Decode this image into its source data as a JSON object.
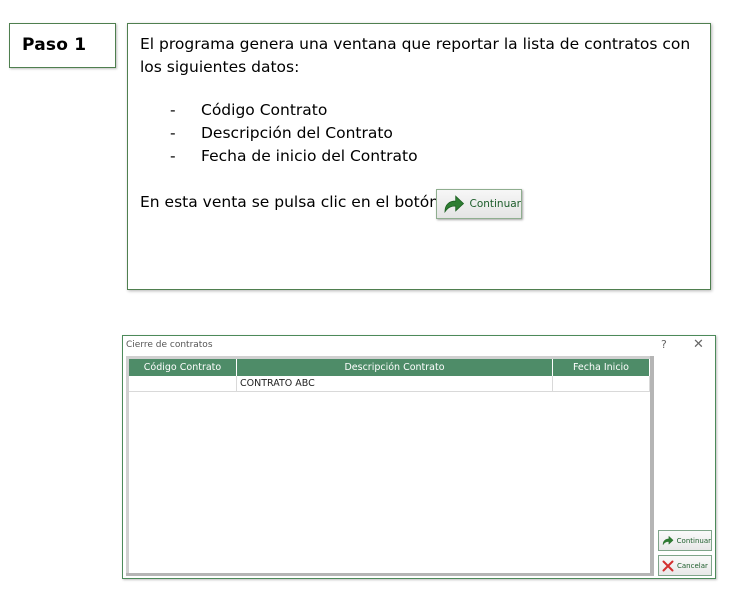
{
  "step": {
    "label": "Paso 1"
  },
  "description": {
    "intro": "El programa genera una ventana que reportar la lista de contratos con los siguientes datos:",
    "bullets": [
      "Código Contrato",
      "Descripción del Contrato",
      "Fecha de inicio del Contrato"
    ],
    "bullet_marker": "-",
    "outro": "En esta venta se pulsa clic en el botón",
    "inline_button_label": "Continuar"
  },
  "window": {
    "title": "Cierre de contratos",
    "help_glyph": "?",
    "close_glyph": "✕",
    "columns": [
      "Código Contrato",
      "Descripción Contrato",
      "Fecha Inicio"
    ],
    "rows": [
      [
        "",
        "CONTRATO ABC",
        ""
      ]
    ],
    "buttons": {
      "continuar": "Continuar",
      "cancelar": "Cancelar"
    }
  },
  "colors": {
    "header_green": "#4e8c68",
    "button_text_green": "#1d5d2b",
    "arrow_green": "#2e7d32",
    "cancel_red": "#d32f2f"
  },
  "icons": {
    "continue": "forward-arrow-icon",
    "cancel": "red-x-icon",
    "close": "close-icon",
    "help": "help-icon"
  }
}
